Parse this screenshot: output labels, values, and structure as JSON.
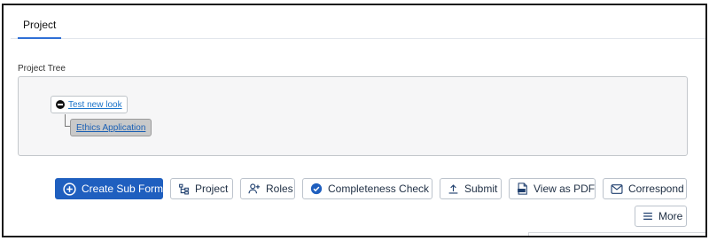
{
  "tabs": [
    {
      "label": "Project",
      "active": true
    }
  ],
  "tree": {
    "label": "Project Tree",
    "root": {
      "label": "Test new look"
    },
    "child": {
      "label": "Ethics Application"
    }
  },
  "actions": {
    "create_sub_form": "Create Sub Form",
    "project": "Project",
    "roles": "Roles",
    "completeness_check": "Completeness Check",
    "submit": "Submit",
    "view_as_pdf": "View as PDF",
    "correspond": "Correspond",
    "more": "More"
  },
  "colors": {
    "primary": "#1f5fbf",
    "link": "#1a73c9",
    "tab_underline": "#2f6fd6"
  }
}
